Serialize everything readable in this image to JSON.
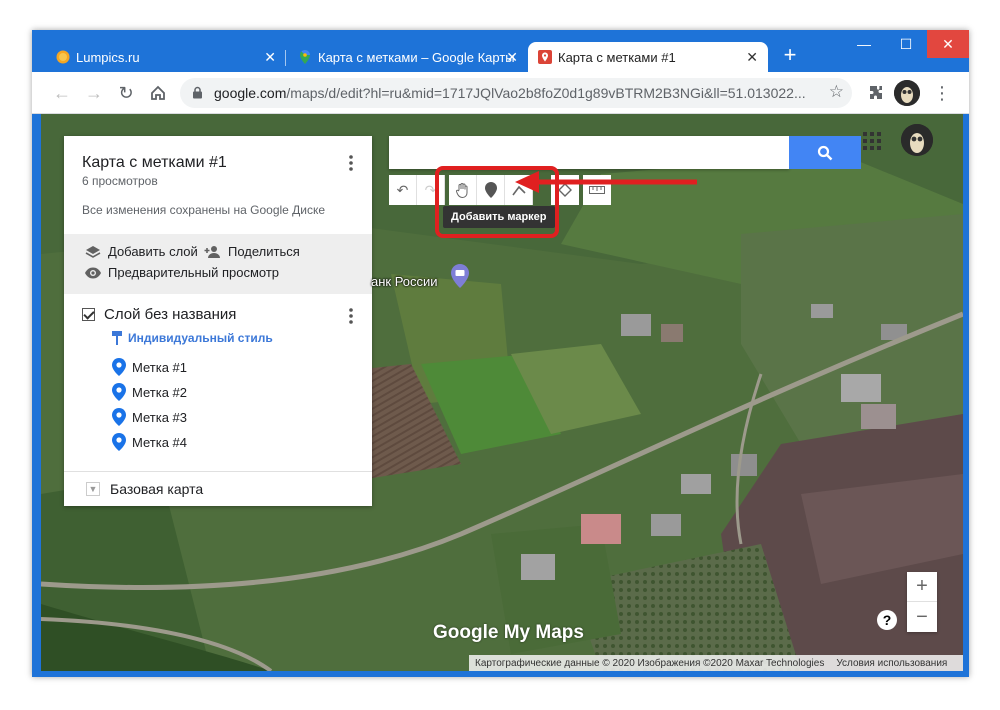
{
  "browser": {
    "tabs": [
      {
        "label": "Lumpics.ru",
        "active": false
      },
      {
        "label": "Карта с метками – Google Карты",
        "active": false
      },
      {
        "label": "Карта с метками #1",
        "active": true
      }
    ],
    "url_main": "google.com",
    "url_rest": "/maps/d/edit?hl=ru&mid=1717JQlVao2b8foZ0d1g89vBTRM2B3NGi&ll=51.013022..."
  },
  "panel": {
    "title": "Карта с метками #1",
    "views": "6 просмотров",
    "saved": "Все изменения сохранены на Google Диске",
    "add_layer": "Добавить слой",
    "share": "Поделиться",
    "preview": "Предварительный просмотр",
    "layer_name": "Слой без названия",
    "style": "Индивидуальный стиль",
    "markers": [
      "Метка #1",
      "Метка #2",
      "Метка #3",
      "Метка #4"
    ],
    "base_map": "Базовая карта"
  },
  "map": {
    "tooltip": "Добавить маркер",
    "poi_label": "анк России",
    "brand": "Google My Maps",
    "attribution": "Картографические данные © 2020 Изображения ©2020 Maxar Technologies",
    "terms": "Условия использования",
    "zoom_in": "+",
    "zoom_out": "−",
    "help": "?"
  },
  "colors": {
    "chrome_blue": "#1e73d8",
    "accent_blue": "#4285f4",
    "marker_blue": "#1a73e8",
    "highlight_red": "#e02020"
  }
}
